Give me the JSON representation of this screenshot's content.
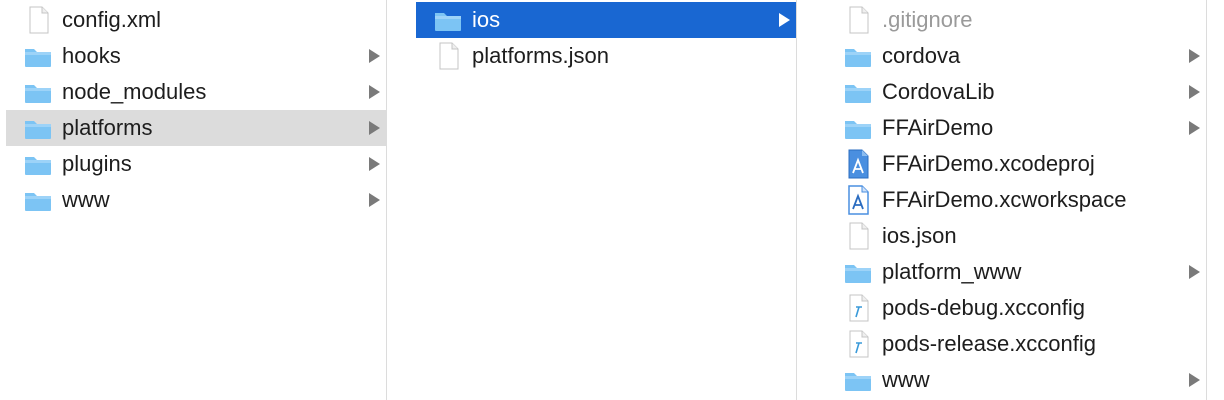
{
  "columns": [
    {
      "items": [
        {
          "label": "config.xml",
          "icon": "document-icon",
          "has_children": false,
          "selected": false
        },
        {
          "label": "hooks",
          "icon": "folder-icon",
          "has_children": true,
          "selected": false
        },
        {
          "label": "node_modules",
          "icon": "folder-icon",
          "has_children": true,
          "selected": false
        },
        {
          "label": "platforms",
          "icon": "folder-icon",
          "has_children": true,
          "selected": true
        },
        {
          "label": "plugins",
          "icon": "folder-icon",
          "has_children": true,
          "selected": false
        },
        {
          "label": "www",
          "icon": "folder-icon",
          "has_children": true,
          "selected": false
        }
      ]
    },
    {
      "items": [
        {
          "label": "ios",
          "icon": "folder-icon",
          "has_children": true,
          "selected": true
        },
        {
          "label": "platforms.json",
          "icon": "document-icon",
          "has_children": false,
          "selected": false
        }
      ]
    },
    {
      "items": [
        {
          "label": ".gitignore",
          "icon": "document-icon",
          "has_children": false,
          "selected": false,
          "muted": true
        },
        {
          "label": "cordova",
          "icon": "folder-icon",
          "has_children": true,
          "selected": false
        },
        {
          "label": "CordovaLib",
          "icon": "folder-icon",
          "has_children": false,
          "selected": false
        },
        {
          "label": "FFAirDemo",
          "icon": "folder-icon",
          "has_children": true,
          "selected": false
        },
        {
          "label": "FFAirDemo.xcodeproj",
          "icon": "xcode-project-icon",
          "has_children": false,
          "selected": false
        },
        {
          "label": "FFAirDemo.xcworkspace",
          "icon": "xcode-workspace-icon",
          "has_children": false,
          "selected": false
        },
        {
          "label": "ios.json",
          "icon": "document-icon",
          "has_children": false,
          "selected": false
        },
        {
          "label": "platform_www",
          "icon": "folder-icon",
          "has_children": true,
          "selected": false
        },
        {
          "label": "pods-debug.xcconfig",
          "icon": "xcconfig-icon",
          "has_children": false,
          "selected": false
        },
        {
          "label": "pods-release.xcconfig",
          "icon": "xcconfig-icon",
          "has_children": false,
          "selected": false
        },
        {
          "label": "www",
          "icon": "folder-icon",
          "has_children": true,
          "selected": false
        }
      ]
    }
  ],
  "colors": {
    "selection_blue": "#1967d2",
    "selection_gray": "#dcdcdc",
    "folder_blue": "#7cc4f4",
    "separator": "#dcdcdc"
  }
}
